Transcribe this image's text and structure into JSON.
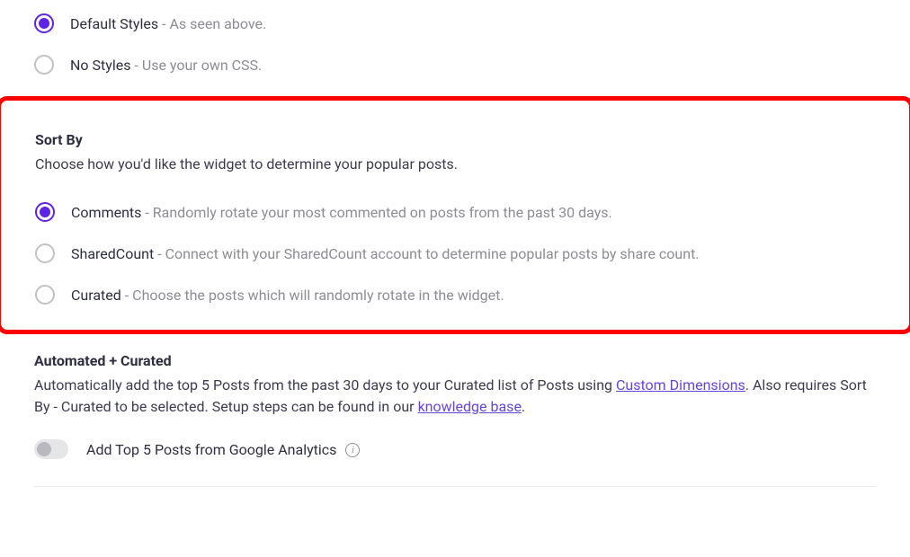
{
  "styles": {
    "option1": {
      "title": "Default Styles",
      "desc": " - As seen above."
    },
    "option2": {
      "title": "No Styles",
      "desc": " - Use your own CSS."
    }
  },
  "sortBy": {
    "title": "Sort By",
    "desc": "Choose how you'd like the widget to determine your popular posts.",
    "option1": {
      "title": "Comments",
      "desc": " - Randomly rotate your most commented on posts from the past 30 days."
    },
    "option2": {
      "title": "SharedCount",
      "desc": " - Connect with your SharedCount account to determine popular posts by share count."
    },
    "option3": {
      "title": "Curated",
      "desc": " - Choose the posts which will randomly rotate in the widget."
    }
  },
  "automated": {
    "title": "Automated + Curated",
    "desc1": "Automatically add the top 5 Posts from the past 30 days to your Curated list of Posts using ",
    "link1": "Custom Dimensions",
    "desc2": ". Also requires Sort By - Curated to be selected. Setup steps can be found in our ",
    "link2": "knowledge base",
    "desc3": ".",
    "toggle_label": "Add Top 5 Posts from Google Analytics"
  }
}
